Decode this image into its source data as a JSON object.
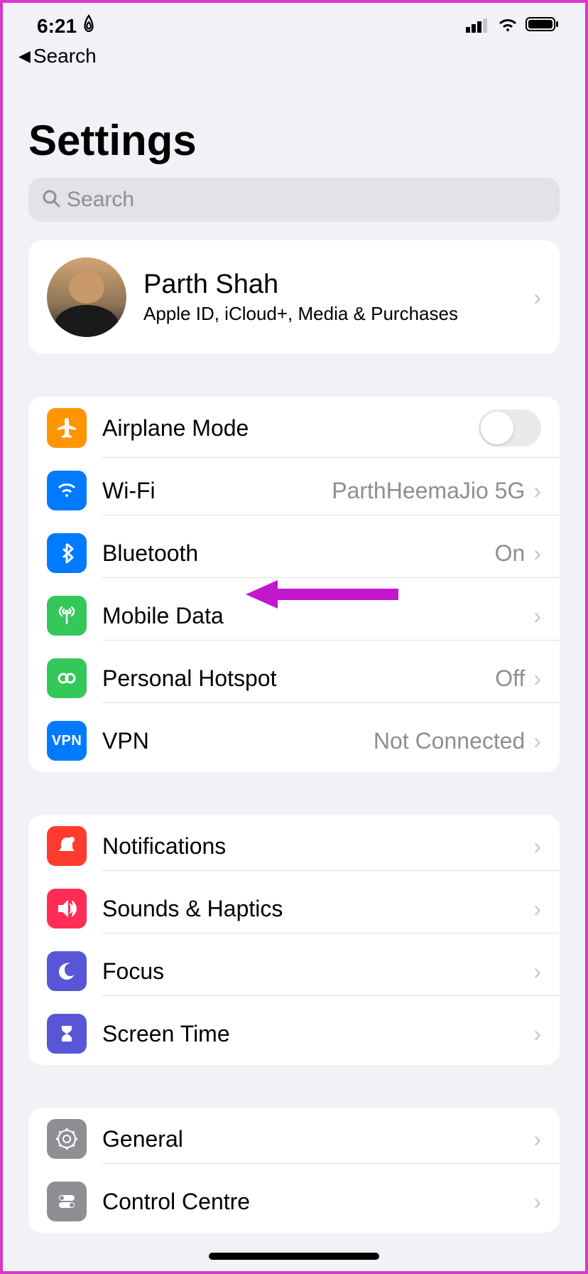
{
  "status": {
    "time": "6:21",
    "back_label": "Search"
  },
  "title": "Settings",
  "search": {
    "placeholder": "Search"
  },
  "profile": {
    "name": "Parth Shah",
    "subtitle": "Apple ID, iCloud+, Media & Purchases"
  },
  "connectivity": {
    "airplane": "Airplane Mode",
    "wifi": {
      "label": "Wi-Fi",
      "value": "ParthHeemaJio 5G"
    },
    "bluetooth": {
      "label": "Bluetooth",
      "value": "On"
    },
    "mobile": "Mobile Data",
    "hotspot": {
      "label": "Personal Hotspot",
      "value": "Off"
    },
    "vpn": {
      "label": "VPN",
      "value": "Not Connected"
    }
  },
  "alerts": {
    "notifications": "Notifications",
    "sounds": "Sounds & Haptics",
    "focus": "Focus",
    "screentime": "Screen Time"
  },
  "general_section": {
    "general": "General",
    "control": "Control Centre"
  },
  "colors": {
    "orange": "#ff9500",
    "blue": "#007aff",
    "green": "#34c759",
    "red": "#ff3b30",
    "pink": "#ff2d55",
    "purple": "#5856d6",
    "gray": "#8e8e93"
  }
}
